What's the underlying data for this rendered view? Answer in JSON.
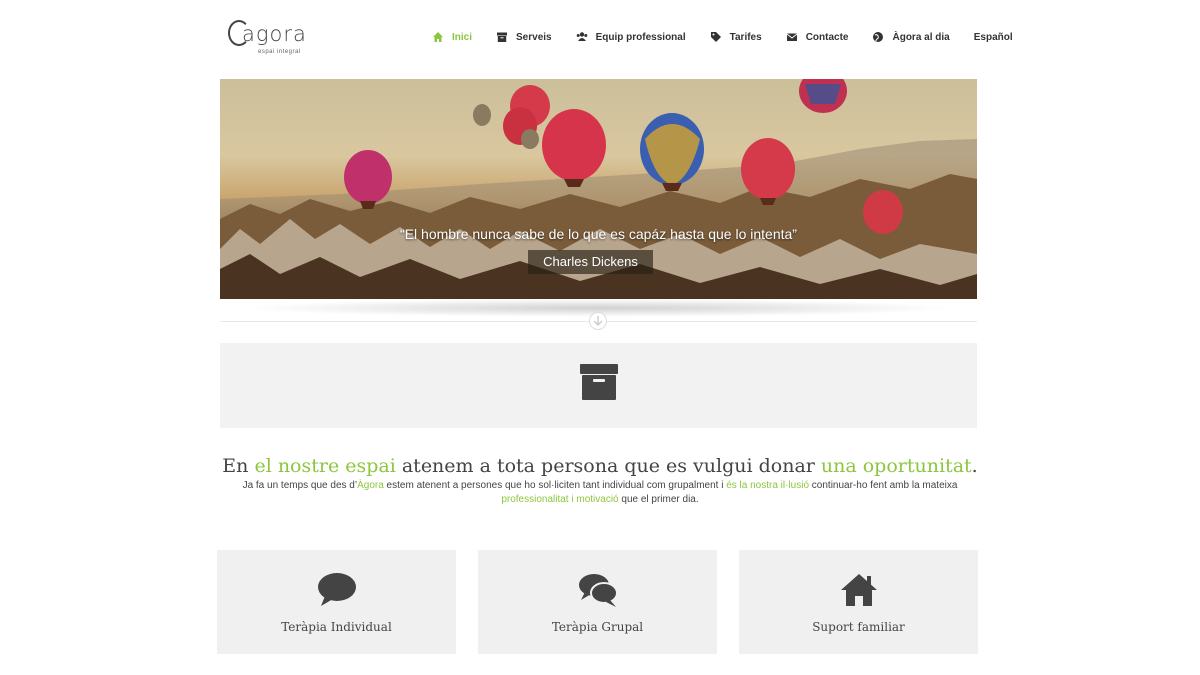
{
  "logo": {
    "word": "agora",
    "tagline": "espai integral"
  },
  "nav": {
    "items": [
      {
        "label": "Inici",
        "icon": "home-icon"
      },
      {
        "label": "Serveis",
        "icon": "archive-icon"
      },
      {
        "label": "Equip professional",
        "icon": "users-icon"
      },
      {
        "label": "Tarifes",
        "icon": "tag-icon"
      },
      {
        "label": "Contacte",
        "icon": "envelope-icon"
      },
      {
        "label": "Àgora al dia",
        "icon": "globe-icon"
      }
    ],
    "language": "Español"
  },
  "hero": {
    "quote": "“El hombre nunca sabe de lo que es capáz hasta que lo intenta”",
    "author": "Charles Dickens"
  },
  "intro": {
    "headline": {
      "p1": "En ",
      "g1": "el nostre espai",
      "p2": " atenem a tota persona que es vulgui donar ",
      "g2": "una oportunitat",
      "p3": "."
    },
    "para": {
      "p1": "Ja fa un temps que des d’",
      "g1": "Àgora",
      "p2": " estem atenent a persones que ho sol·liciten tant individual com grupalment i ",
      "g2": "és la nostra il·lusió",
      "p3": " continuar-ho fent amb la mateixa ",
      "g3": "professionalitat i motivació",
      "p4": " que el primer dia."
    }
  },
  "cards": [
    {
      "label": "Teràpia Individual",
      "icon": "comment-icon"
    },
    {
      "label": "Teràpia Grupal",
      "icon": "comments-icon"
    },
    {
      "label": "Suport familiar",
      "icon": "house-icon"
    }
  ],
  "colors": {
    "accent": "#8cc63f",
    "text": "#444444",
    "panel": "#f0f0f0"
  }
}
